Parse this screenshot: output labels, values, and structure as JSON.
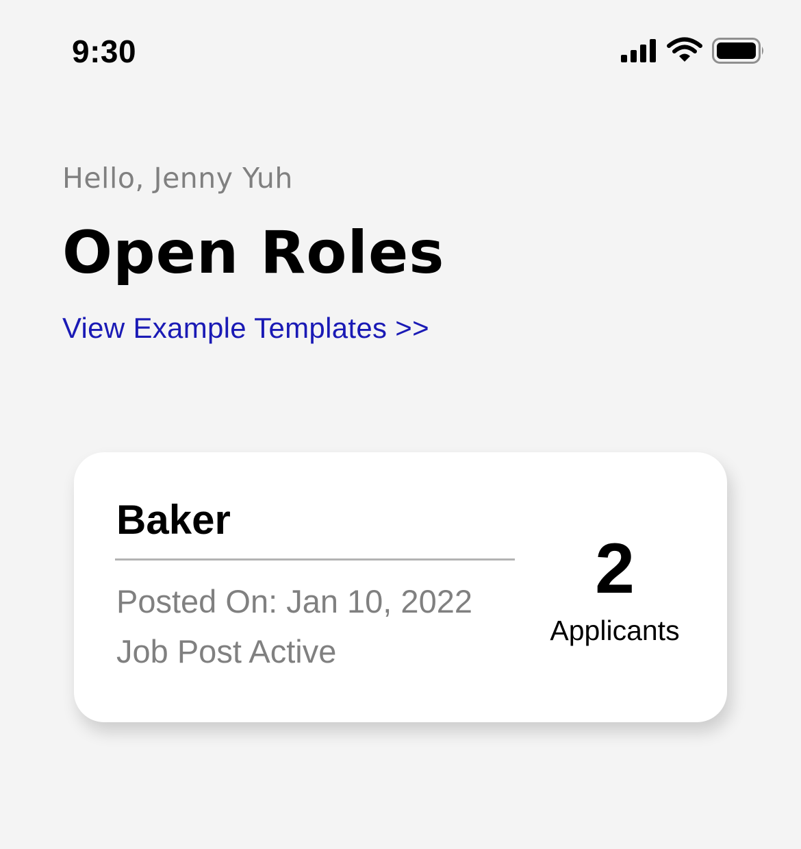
{
  "status_bar": {
    "time": "9:30",
    "icons": [
      "signal-icon",
      "wifi-icon",
      "battery-icon"
    ]
  },
  "header": {
    "greeting": "Hello, Jenny Yuh",
    "title": "Open Roles",
    "templates_link": "View Example Templates >>"
  },
  "roles": [
    {
      "title": "Baker",
      "posted_on": "Posted On: Jan 10, 2022",
      "status": "Job Post Active",
      "applicant_count": "2",
      "applicant_label": "Applicants"
    }
  ],
  "colors": {
    "background": "#f4f4f4",
    "link": "#1a1ab5",
    "muted_text": "#808080",
    "card": "#ffffff"
  }
}
